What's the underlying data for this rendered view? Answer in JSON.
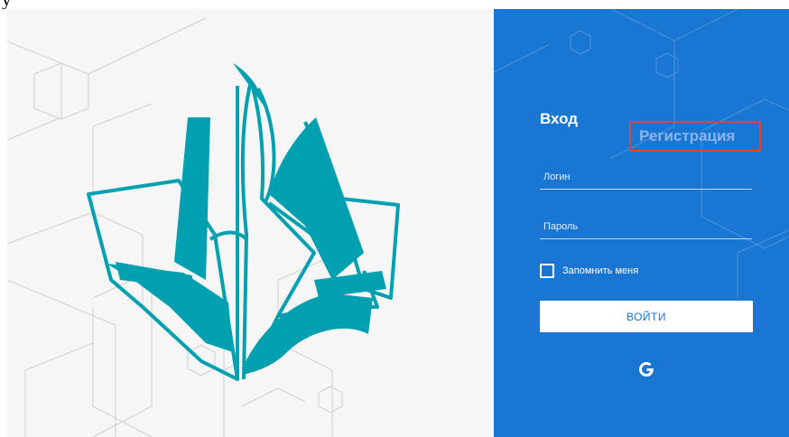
{
  "login_form": {
    "tab_login": "Вход",
    "tab_register": "Регистрация",
    "login_placeholder": "Логин",
    "password_placeholder": "Пароль",
    "remember_label": "Запомнить меня",
    "submit_label": "ВОЙТИ",
    "social_icon": "google-icon"
  },
  "colors": {
    "panel_blue": "#1976d2",
    "logo_teal": "#00a0b0",
    "highlight_red": "#e2403a",
    "left_background": "#f6f6f6"
  }
}
